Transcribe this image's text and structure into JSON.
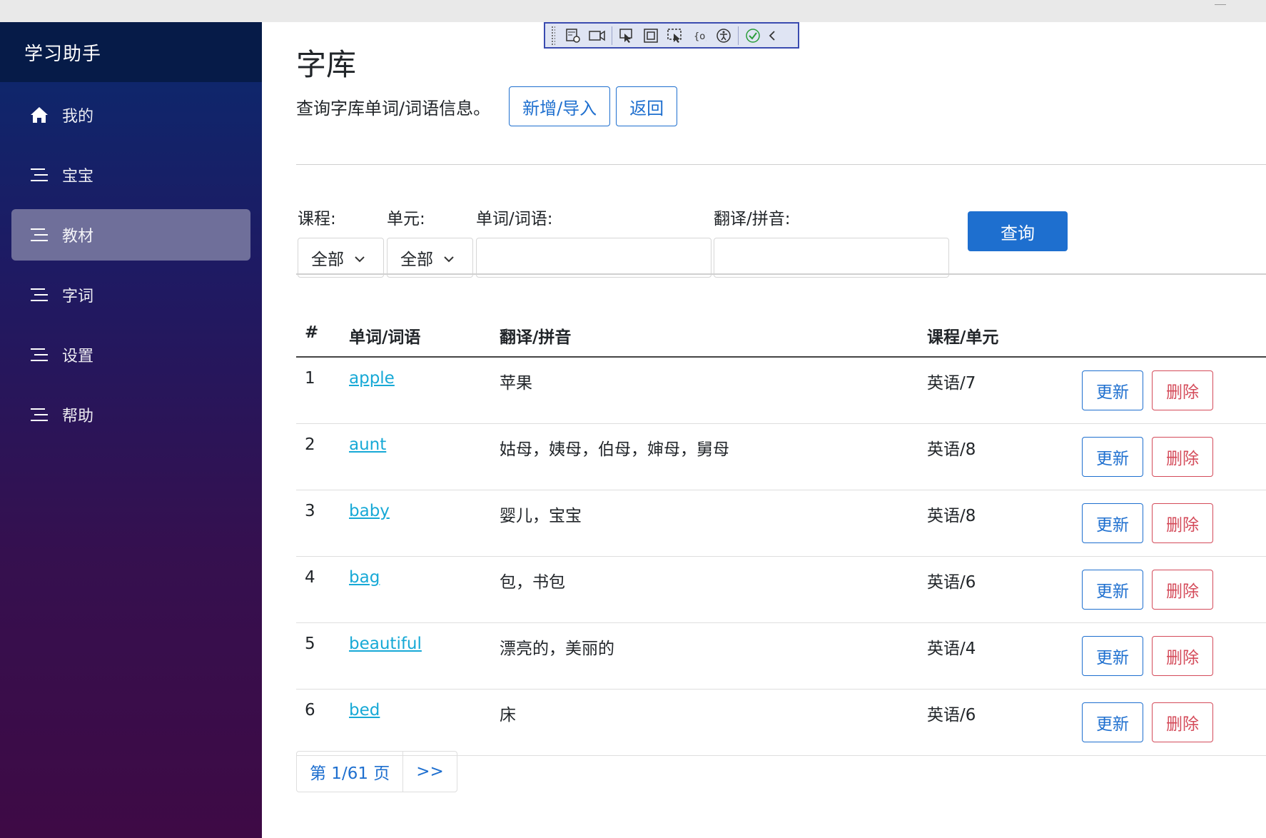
{
  "sidebar": {
    "brand": "学习助手",
    "items": [
      {
        "label": "我的",
        "icon": "home-icon",
        "active": false
      },
      {
        "label": "宝宝",
        "icon": "list-icon",
        "active": false
      },
      {
        "label": "教材",
        "icon": "list-icon",
        "active": true
      },
      {
        "label": "字词",
        "icon": "list-icon",
        "active": false
      },
      {
        "label": "设置",
        "icon": "list-icon",
        "active": false
      },
      {
        "label": "帮助",
        "icon": "list-icon",
        "active": false
      }
    ]
  },
  "header": {
    "title": "字库",
    "description": "查询字库单词/词语信息。",
    "add_label": "新增/导入",
    "back_label": "返回"
  },
  "filters": {
    "course_label": "课程:",
    "course_value": "全部",
    "unit_label": "单元:",
    "unit_value": "全部",
    "word_label": "单词/词语:",
    "word_value": "",
    "translation_label": "翻译/拼音:",
    "translation_value": "",
    "search_label": "查询"
  },
  "table": {
    "columns": [
      "#",
      "单词/词语",
      "翻译/拼音",
      "课程/单元"
    ],
    "update_label": "更新",
    "delete_label": "删除",
    "rows": [
      {
        "num": "1",
        "word": "apple",
        "translation": "苹果",
        "course": "英语/7"
      },
      {
        "num": "2",
        "word": "aunt",
        "translation": "姑母，姨母，伯母，婶母，舅母",
        "course": "英语/8"
      },
      {
        "num": "3",
        "word": "baby",
        "translation": "婴儿，宝宝",
        "course": "英语/8"
      },
      {
        "num": "4",
        "word": "bag",
        "translation": "包，书包",
        "course": "英语/6"
      },
      {
        "num": "5",
        "word": "beautiful",
        "translation": "漂亮的，美丽的",
        "course": "英语/4"
      },
      {
        "num": "6",
        "word": "bed",
        "translation": "床",
        "course": "英语/6"
      }
    ]
  },
  "pagination": {
    "page_label": "第 1/61 页",
    "next_label": ">>"
  },
  "colors": {
    "primary": "#1e6fcf",
    "danger": "#d44b5a",
    "link": "#17a9d6",
    "sidebar_active": "#6f6f9a"
  }
}
